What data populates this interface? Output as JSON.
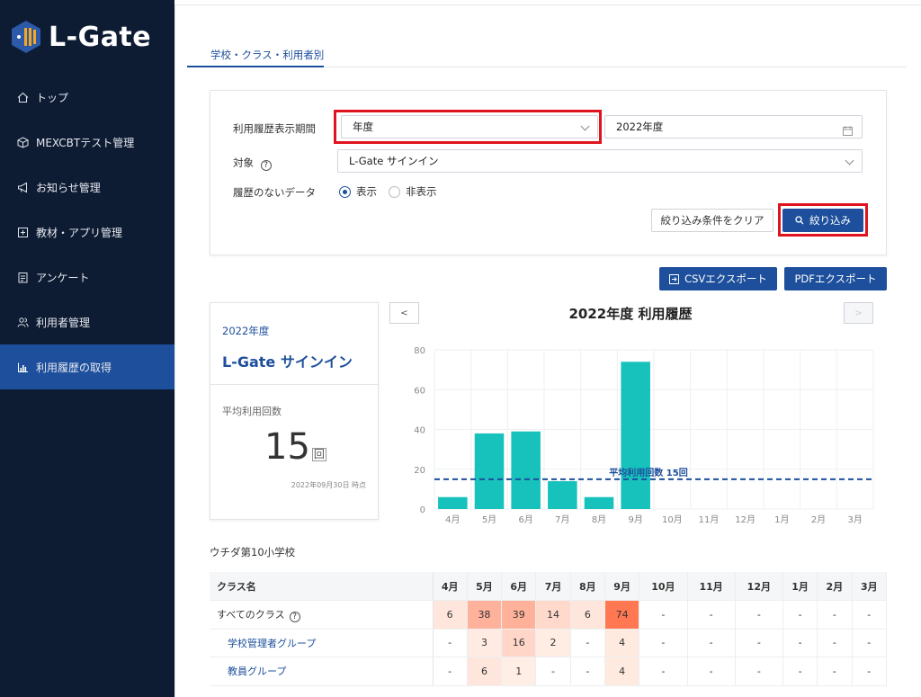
{
  "app": {
    "name": "L-Gate"
  },
  "sidebar": {
    "items": [
      {
        "label": "トップ",
        "icon": "home-icon"
      },
      {
        "label": "MEXCBTテスト管理",
        "icon": "cube-icon"
      },
      {
        "label": "お知らせ管理",
        "icon": "megaphone-icon"
      },
      {
        "label": "教材・アプリ管理",
        "icon": "plus-square-icon"
      },
      {
        "label": "アンケート",
        "icon": "clipboard-icon"
      },
      {
        "label": "利用者管理",
        "icon": "users-icon"
      },
      {
        "label": "利用履歴の取得",
        "icon": "bar-chart-icon"
      }
    ],
    "active_index": 6
  },
  "tab": {
    "label": "学校・クラス・利用者別"
  },
  "filter": {
    "period_label": "利用履歴表示期間",
    "period_type_value": "年度",
    "period_value": "2022年度",
    "target_label": "対象",
    "target_value": "L-Gate サインイン",
    "nodata_label": "履歴のないデータ",
    "radio_show": "表示",
    "radio_hide": "非表示",
    "radio_selected": "show",
    "clear_button": "絞り込み条件をクリア",
    "apply_button": "絞り込み"
  },
  "export": {
    "csv_label": "CSVエクスポート",
    "pdf_label": "PDFエクスポート"
  },
  "summary": {
    "year": "2022年度",
    "target": "L-Gate サインイン",
    "avg_label": "平均利用回数",
    "avg_value": "15",
    "avg_unit": "回",
    "as_of": "2022年09月30日 時点"
  },
  "chart_nav": {
    "prev": "<",
    "next": ">"
  },
  "chart_data": {
    "type": "bar",
    "title": "2022年度 利用履歴",
    "categories": [
      "4月",
      "5月",
      "6月",
      "7月",
      "8月",
      "9月",
      "10月",
      "11月",
      "12月",
      "1月",
      "2月",
      "3月"
    ],
    "values": [
      6,
      38,
      39,
      14,
      6,
      74,
      null,
      null,
      null,
      null,
      null,
      null
    ],
    "ylim": [
      0,
      80
    ],
    "yticks": [
      0,
      20,
      40,
      60,
      80
    ],
    "average": {
      "value": 15,
      "label": "平均利用回数 15回"
    },
    "bar_color": "#17c2bd",
    "avg_color": "#1d4f9c",
    "grid": true
  },
  "school": {
    "name": "ウチダ第10小学校"
  },
  "table": {
    "headers": [
      "クラス名",
      "4月",
      "5月",
      "6月",
      "7月",
      "8月",
      "9月",
      "10月",
      "11月",
      "12月",
      "1月",
      "2月",
      "3月"
    ],
    "rows": [
      {
        "name": "すべてのクラス",
        "values": [
          "6",
          "38",
          "39",
          "14",
          "6",
          "74",
          "-",
          "-",
          "-",
          "-",
          "-",
          "-"
        ]
      },
      {
        "name": "学校管理者グループ",
        "values": [
          "-",
          "3",
          "16",
          "2",
          "-",
          "4",
          "-",
          "-",
          "-",
          "-",
          "-",
          "-"
        ]
      },
      {
        "name": "教員グループ",
        "values": [
          "-",
          "6",
          "1",
          "-",
          "-",
          "4",
          "-",
          "-",
          "-",
          "-",
          "-",
          "-"
        ]
      }
    ]
  }
}
